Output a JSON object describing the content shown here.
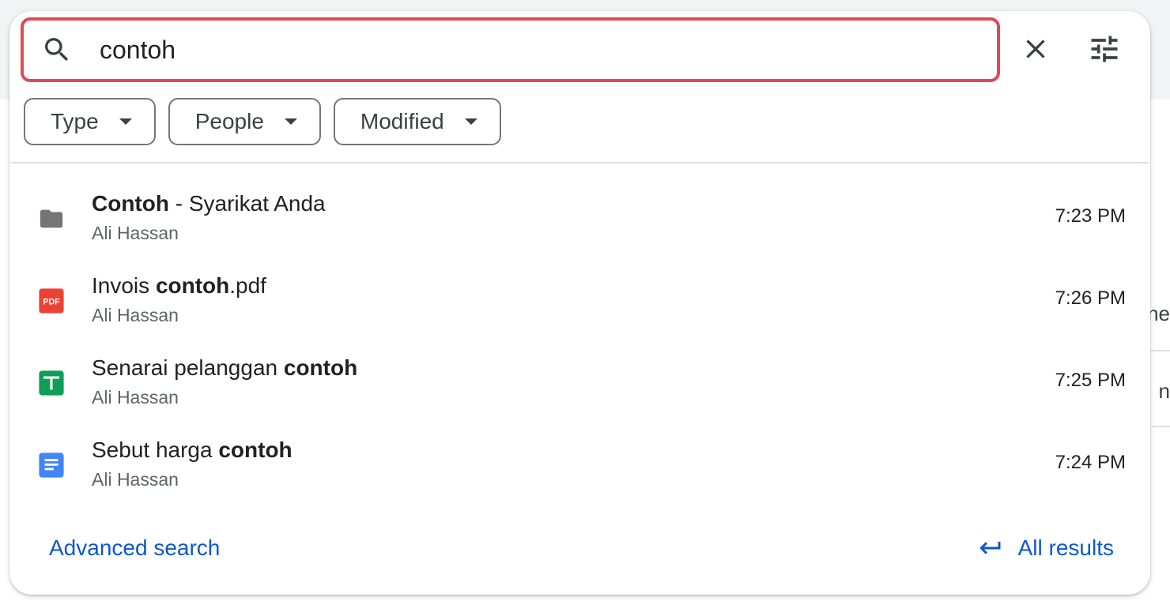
{
  "search": {
    "value": "contoh",
    "clear_icon": "close-icon",
    "options_icon": "tune-icon"
  },
  "filters": [
    {
      "label": "Type"
    },
    {
      "label": "People"
    },
    {
      "label": "Modified"
    }
  ],
  "results": [
    {
      "title_before": "",
      "title_bold": "Contoh",
      "title_after": " - Syarikat Anda",
      "owner": "Ali Hassan",
      "time": "7:23 PM",
      "icon": "folder-icon"
    },
    {
      "title_before": "Invois ",
      "title_bold": "contoh",
      "title_after": ".pdf",
      "owner": "Ali Hassan",
      "time": "7:26 PM",
      "icon": "pdf-icon"
    },
    {
      "title_before": "Senarai pelanggan ",
      "title_bold": "contoh",
      "title_after": "",
      "owner": "Ali Hassan",
      "time": "7:25 PM",
      "icon": "sheets-icon"
    },
    {
      "title_before": "Sebut harga ",
      "title_bold": "contoh",
      "title_after": "",
      "owner": "Ali Hassan",
      "time": "7:24 PM",
      "icon": "docs-icon"
    }
  ],
  "footer": {
    "advanced_search": "Advanced search",
    "all_results": "All results"
  },
  "background": {
    "fragment_1": "ne",
    "fragment_2": "n"
  },
  "colors": {
    "focus_border": "#dc4b56",
    "link": "#0b57d0",
    "pdf": "#ea4335",
    "sheets": "#0f9d58",
    "docs": "#4285f4",
    "folder": "#757575"
  }
}
